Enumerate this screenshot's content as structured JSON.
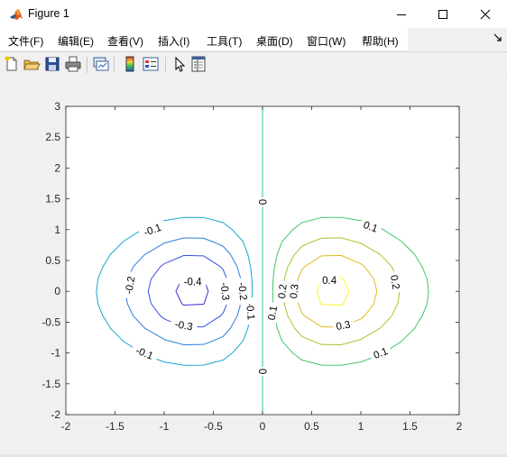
{
  "window": {
    "title": "Figure 1",
    "minimize_glyph": "—",
    "maximize_glyph": "☐",
    "close_glyph": "✕"
  },
  "menu": {
    "items": [
      "文件(F)",
      "编辑(E)",
      "查看(V)",
      "插入(I)",
      "工具(T)",
      "桌面(D)",
      "窗口(W)",
      "帮助(H)"
    ]
  },
  "toolbar": {
    "buttons": [
      "new-figure-icon",
      "open-file-icon",
      "save-icon",
      "print-icon",
      "link-plot-icon",
      "insert-colorbar-icon",
      "insert-legend-icon",
      "edit-plot-pointer-icon",
      "property-inspector-icon"
    ]
  },
  "colors": {
    "level_-0.4": "#3c2ecb",
    "level_-0.3": "#3b4fe6",
    "level_-0.2": "#2a7ed9",
    "level_-0.1": "#16a6d6",
    "level_0": "#1ec4a5",
    "level_0.1": "#44c568",
    "level_0.2": "#aec12f",
    "level_0.3": "#dfbb21",
    "level_0.4": "#fbf524"
  },
  "chart_data": {
    "type": "contour",
    "function": "z = x*exp(-x^2 - y^2)",
    "levels": [
      -0.4,
      -0.3,
      -0.2,
      -0.1,
      0,
      0.1,
      0.2,
      0.3,
      0.4
    ],
    "xlim": [
      -2,
      2
    ],
    "ylim": [
      -2,
      3
    ],
    "xticks": [
      "-2",
      "-1.5",
      "-1",
      "-0.5",
      "0",
      "0.5",
      "1",
      "1.5",
      "2"
    ],
    "yticks": [
      "-2",
      "-1.5",
      "-1",
      "-0.5",
      "0",
      "0.5",
      "1",
      "1.5",
      "2",
      "2.5",
      "3"
    ],
    "title": "",
    "xlabel": "",
    "ylabel": "",
    "contour_labels": [
      {
        "text": "-0.1",
        "x": -1.12,
        "y": 1.0,
        "rot": -20
      },
      {
        "text": "-0.1",
        "x": -1.2,
        "y": -1.0,
        "rot": 22
      },
      {
        "text": "-0.1",
        "x": -0.12,
        "y": -0.32,
        "rot": 85
      },
      {
        "text": "-0.2",
        "x": -1.35,
        "y": 0.1,
        "rot": -80
      },
      {
        "text": "-0.2",
        "x": -0.2,
        "y": 0.0,
        "rot": 84
      },
      {
        "text": "-0.3",
        "x": -0.8,
        "y": -0.55,
        "rot": 10
      },
      {
        "text": "-0.3",
        "x": -0.38,
        "y": 0.0,
        "rot": 84
      },
      {
        "text": "-0.4",
        "x": -0.71,
        "y": 0.16,
        "rot": 0
      },
      {
        "text": "0",
        "x": 0.0,
        "y": 1.45,
        "rot": 90
      },
      {
        "text": "0",
        "x": 0.0,
        "y": -1.3,
        "rot": 90
      },
      {
        "text": "0.1",
        "x": 1.1,
        "y": 1.05,
        "rot": 20
      },
      {
        "text": "0.1",
        "x": 1.2,
        "y": -1.0,
        "rot": -22
      },
      {
        "text": "0.1",
        "x": 0.1,
        "y": -0.35,
        "rot": -80
      },
      {
        "text": "0.2",
        "x": 1.35,
        "y": 0.15,
        "rot": 80
      },
      {
        "text": "0.2",
        "x": 0.2,
        "y": 0.0,
        "rot": -84
      },
      {
        "text": "0.3",
        "x": 0.82,
        "y": -0.55,
        "rot": -10
      },
      {
        "text": "0.3",
        "x": 0.32,
        "y": 0.0,
        "rot": -84
      },
      {
        "text": "0.4",
        "x": 0.68,
        "y": 0.18,
        "rot": 0
      }
    ]
  }
}
